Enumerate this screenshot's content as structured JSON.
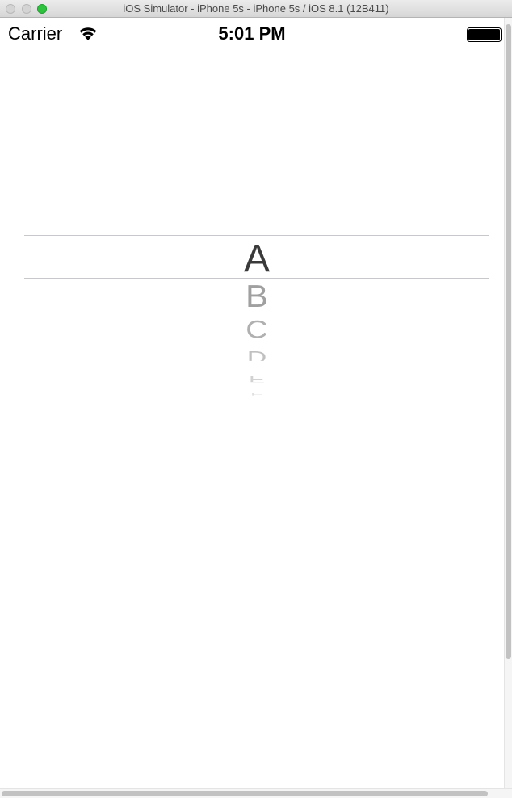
{
  "window": {
    "title": "iOS Simulator - iPhone 5s - iPhone 5s / iOS 8.1 (12B411)"
  },
  "status_bar": {
    "carrier": "Carrier",
    "time": "5:01 PM",
    "wifi_icon": "wifi-icon",
    "battery_icon": "battery-full-icon"
  },
  "picker": {
    "selected": "A",
    "rows": [
      "A",
      "B",
      "C",
      "D",
      "E",
      "F"
    ]
  },
  "colors": {
    "zoom_button": "#2ec23e",
    "selected_text": "#3a3a3a",
    "unselected_text": "#a0a0a0",
    "separator": "#c8c8cc"
  }
}
